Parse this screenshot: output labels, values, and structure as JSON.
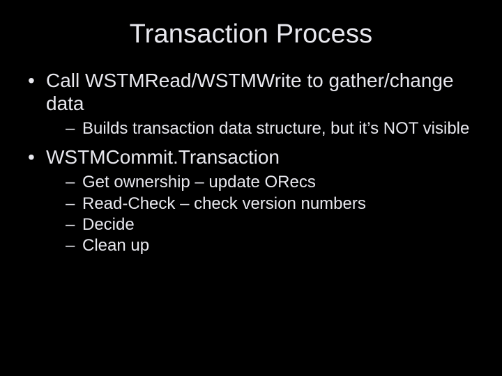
{
  "title": "Transaction Process",
  "bullets": [
    {
      "text": "Call WSTMRead/WSTMWrite to gather/change data",
      "sub": [
        "Builds transaction data structure, but it’s NOT visible"
      ]
    },
    {
      "text": "WSTMCommit.Transaction",
      "sub": [
        "Get ownership – update ORecs",
        "Read-Check – check version numbers",
        "Decide",
        "Clean up"
      ]
    }
  ]
}
